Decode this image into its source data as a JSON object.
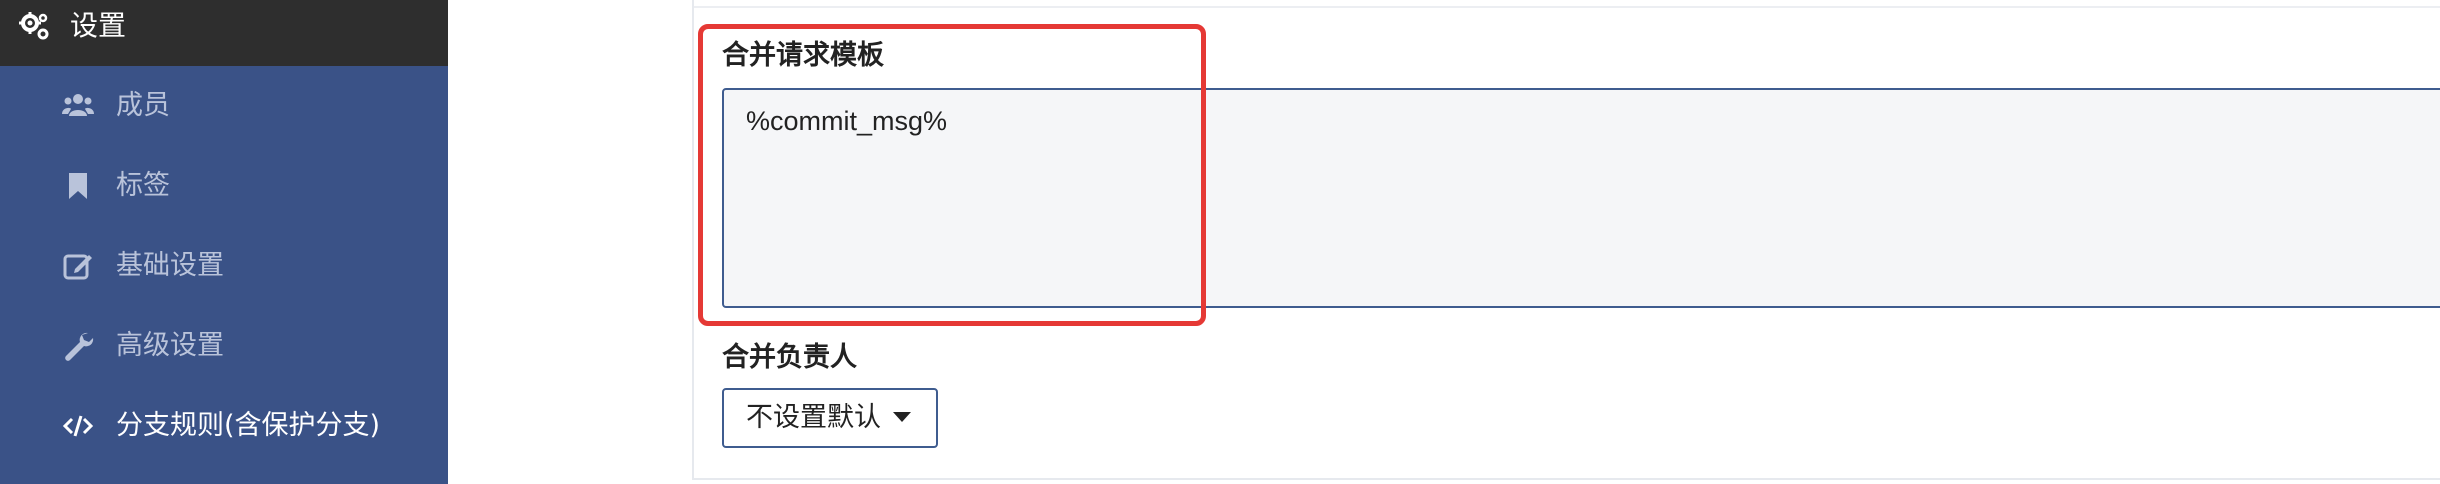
{
  "sidebar": {
    "header": {
      "label": "设置",
      "icon": "gears-icon"
    },
    "items": [
      {
        "label": "成员",
        "icon": "users-icon"
      },
      {
        "label": "标签",
        "icon": "bookmark-icon"
      },
      {
        "label": "基础设置",
        "icon": "edit-icon"
      },
      {
        "label": "高级设置",
        "icon": "wrench-icon"
      },
      {
        "label": "分支规则(含保护分支)",
        "icon": "code-icon",
        "active": true
      }
    ]
  },
  "main": {
    "merge_template": {
      "label": "合并请求模板",
      "value": "%commit_msg%"
    },
    "merge_owner": {
      "label": "合并负责人",
      "selected": "不设置默认"
    }
  },
  "colors": {
    "sidebar_bg": "#3a5287",
    "sidebar_header_bg": "#2e2e2e",
    "highlight": "#e53935",
    "input_border": "#3f5c8f"
  }
}
